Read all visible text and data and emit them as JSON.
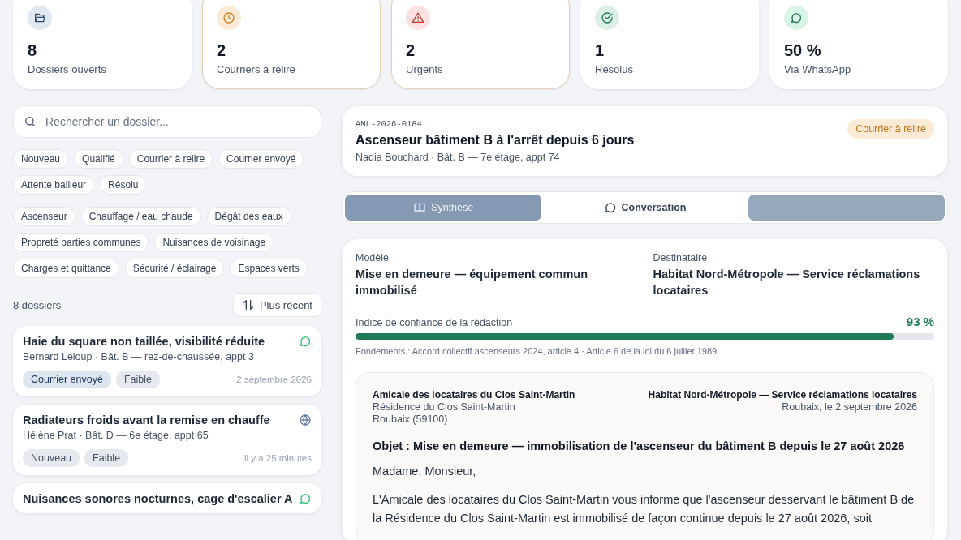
{
  "stats": [
    {
      "kind": "folder",
      "value": "8",
      "label": "Dossiers ouverts",
      "highlighted": false
    },
    {
      "kind": "clock",
      "value": "2",
      "label": "Courriers à relire",
      "highlighted": true
    },
    {
      "kind": "alert",
      "value": "2",
      "label": "Urgents",
      "highlighted": true
    },
    {
      "kind": "check",
      "value": "1",
      "label": "Résolus",
      "highlighted": false
    },
    {
      "kind": "chat",
      "value": "50 %",
      "label": "Via WhatsApp",
      "highlighted": false
    }
  ],
  "search": {
    "placeholder": "Rechercher un dossier..."
  },
  "status_filters": [
    {
      "label": "Nouveau",
      "selected": false
    },
    {
      "label": "Qualifié",
      "selected": false
    },
    {
      "label": "Courrier à relire",
      "selected": false
    },
    {
      "label": "Courrier envoyé",
      "selected": false
    },
    {
      "label": "Attente bailleur",
      "selected": false
    },
    {
      "label": "Résolu",
      "selected": false
    }
  ],
  "category_filters": [
    {
      "label": "Ascenseur",
      "selected": false
    },
    {
      "label": "Chauffage / eau chaude",
      "selected": false
    },
    {
      "label": "Dégât des eaux",
      "selected": false
    },
    {
      "label": "Propreté parties communes",
      "selected": false
    },
    {
      "label": "Nuisances de voisinage",
      "selected": false
    },
    {
      "label": "Charges et quittance",
      "selected": false
    },
    {
      "label": "Sécurité / éclairage",
      "selected": false
    },
    {
      "label": "Espaces verts",
      "selected": false
    }
  ],
  "list": {
    "count": "8 dossiers",
    "sort": "Plus récent"
  },
  "cases": [
    {
      "title": "Haie du square non taillée, visibilité réduite",
      "kind": "whatsapp",
      "tenant": "Bernard Leloup · Bât. B — rez-de-chaussée, appt 3",
      "tags": [
        {
          "label": "Courrier envoyé",
          "kind": "status"
        },
        {
          "label": "Faible",
          "kind": "priority"
        }
      ],
      "time": "2 septembre 2026"
    },
    {
      "title": "Radiateurs froids avant la remise en chauffe",
      "kind": "web",
      "tenant": "Hélène Prat · Bât. D — 6e étage, appt 65",
      "tags": [
        {
          "label": "Nouveau",
          "kind": "priority"
        },
        {
          "label": "Faible",
          "kind": "priority"
        }
      ],
      "time": "il y a 25 minutes"
    },
    {
      "title": "Nuisances sonores nocturnes, cage d'escalier A",
      "kind": "whatsapp"
    }
  ],
  "detail": {
    "reference": "AML-2026-0184",
    "title": "Ascenseur bâtiment B à l'arrêt depuis 6 jours",
    "tenant": "Nadia Bouchard · Bât. B — 7e étage, appt 74",
    "status": "Courrier à relire"
  },
  "tabs": [
    {
      "label": "Synthèse",
      "kind": "book",
      "selected": false
    },
    {
      "label": "Conversation",
      "kind": "chat",
      "selected": true
    },
    {
      "kind": "blank",
      "selected": false
    }
  ],
  "draft": {
    "model_label": "Modèle",
    "model": "Mise en demeure — équipement commun immobilisé",
    "recipient_label": "Destinataire",
    "recipient": "Habitat Nord-Métropole — Service réclamations locataires",
    "confidence_label": "Indice de confiance de la rédaction",
    "confidence": "93 %",
    "level": 0.93,
    "basis": "Fondements : Accord collectif ascenseurs 2024, article 4 · Article 6 de la loi du 6 juillet 1989"
  },
  "letter": {
    "sender": "Amicale des locataires du Clos Saint-Martin",
    "sender_lines": [
      "Résidence du Clos Saint-Martin",
      "Roubaix (59100)"
    ],
    "recipient": "Habitat Nord-Métropole — Service réclamations locataires",
    "place_date": "Roubaix, le 2 septembre 2026",
    "subject": "Objet : Mise en demeure — immobilisation de l'ascenseur du bâtiment B depuis le 27 août 2026",
    "greeting": "Madame, Monsieur,",
    "body": "L'Amicale des locataires du Clos Saint-Martin vous informe que l'ascenseur desservant le bâtiment B de la Résidence du Clos Saint-Martin est immobilisé de façon continue depuis le 27 août 2026, soit"
  }
}
